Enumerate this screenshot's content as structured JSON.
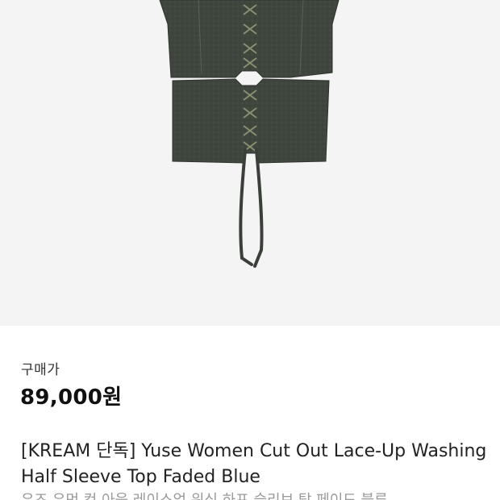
{
  "product": {
    "image_icon": "product-photo",
    "price_label": "구매가",
    "price": "89,000원",
    "title": "[KREAM 단독] Yuse Women Cut Out Lace-Up Washing Half Sleeve Top Faded Blue",
    "subtitle": "유즈 우먼 컷 아웃 레이스업 워싱 하프 슬리브 탑 페이드 블루"
  },
  "colors": {
    "image_bg": "#f4f4f4",
    "garment": "#3e453d",
    "price": "#111111",
    "subtitle": "#9a9a9a"
  }
}
